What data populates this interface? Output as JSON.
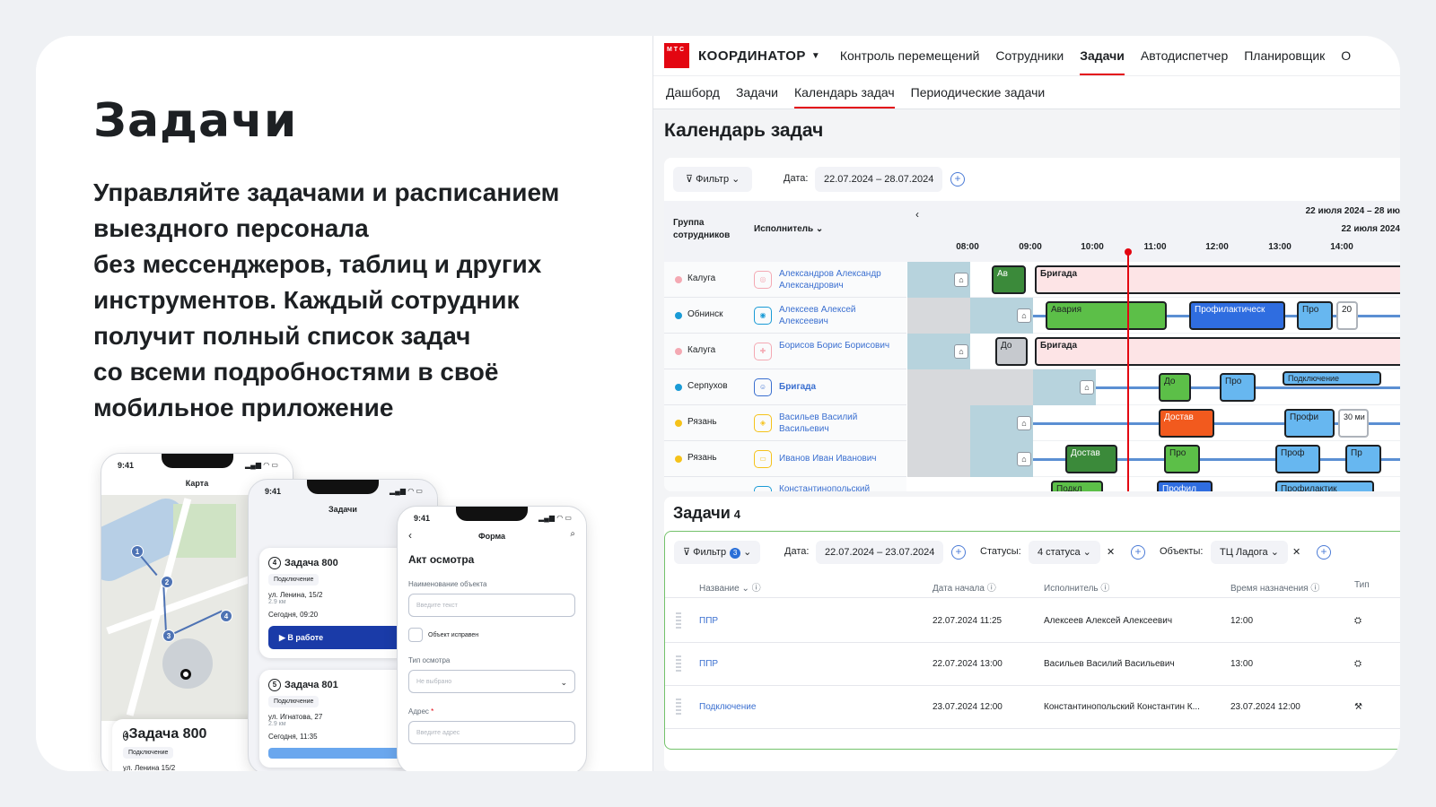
{
  "promo": {
    "title": "Задачи",
    "text": "Управляйте задачами и расписанием\nвыездного персонала\nбез мессенджеров, таблиц и других\nинструментов. Каждый сотрудник\nполучит полный список задач\nсо всеми подробностями в своё\nмобильное приложение"
  },
  "phones": {
    "map": {
      "time": "9:41",
      "title": "Карта",
      "task_title": "Задача 800",
      "task_num": "4",
      "chip": "Подключение",
      "address": "ул. Ленина 15/2",
      "pins": [
        "1",
        "2",
        "3",
        "4"
      ]
    },
    "list": {
      "time": "9:41",
      "title": "Задачи",
      "tasks": [
        {
          "num": "4",
          "title": "Задача 800",
          "chip": "Подключение",
          "address": "ул. Ленина, 15/2",
          "dist": "2.9 км",
          "when": "Сегодня, 09:20",
          "button": "▶ В работе"
        },
        {
          "num": "5",
          "title": "Задача 801",
          "chip": "Подключение",
          "address": "ул. Игнатова, 27",
          "dist": "2.9 км",
          "when": "Сегодня, 11:35"
        }
      ]
    },
    "form": {
      "time": "9:41",
      "title": "Форма",
      "heading": "Акт осмотра",
      "object_label": "Наименование объекта",
      "object_placeholder": "Введите текст",
      "checkbox": "Объект исправен",
      "type_label": "Тип осмотра",
      "type_placeholder": "Не выбрано",
      "address_label": "Адрес",
      "address_placeholder": "Введите адрес"
    }
  },
  "app": {
    "logo_text": "М Т С",
    "brand": "КООРДИНАТОР",
    "nav": [
      "Контроль перемещений",
      "Сотрудники",
      "Задачи",
      "Автодиспетчер",
      "Планировщик",
      "О"
    ],
    "nav_active": "Задачи",
    "subnav": [
      "Дашборд",
      "Задачи",
      "Календарь задач",
      "Периодические задачи"
    ],
    "subnav_active": "Календарь задач",
    "page_title": "Календарь задач",
    "calendar": {
      "filter_label": "Фильтр",
      "date_label": "Дата:",
      "date_range": "22.07.2024 – 28.07.2024",
      "col_group": "Группа сотрудников",
      "col_exec": "Исполнитель",
      "range_title": "22 июля 2024 – 28 июл",
      "day_title": "22 июля 2024",
      "hours": [
        "08:00",
        "09:00",
        "10:00",
        "11:00",
        "12:00",
        "13:00",
        "14:00"
      ],
      "rows": [
        {
          "city": "Калуга",
          "dot": "#f4a9b3",
          "name": "Александров Александр Александрович",
          "ava_color": "#f4a9b3"
        },
        {
          "city": "Обнинск",
          "dot": "#1a9bd6",
          "name": "Алексеев Алексей Алексеевич",
          "ava_color": "#1a9bd6"
        },
        {
          "city": "Калуга",
          "dot": "#f4a9b3",
          "name": "Борисов Борис Борисович",
          "ava_color": "#f4a9b3"
        },
        {
          "city": "Серпухов",
          "dot": "#1a9bd6",
          "name": "Бригада",
          "ava_color": "#3a6fd0"
        },
        {
          "city": "Рязань",
          "dot": "#f5c21a",
          "name": "Васильев Василий Васильевич",
          "ava_color": "#f5c21a"
        },
        {
          "city": "Рязань",
          "dot": "#f5c21a",
          "name": "Иванов Иван Иванович",
          "ava_color": "#f5c21a"
        },
        {
          "city": "",
          "dot": "#1a9bd6",
          "name": "Константинопольский",
          "ava_color": "#1a9bd6"
        }
      ],
      "blocks": {
        "r0": [
          "Ав",
          "Бригада"
        ],
        "r1": [
          "Авария",
          "Профилактическ",
          "Про",
          "20"
        ],
        "r2": [
          "До",
          "Бригада"
        ],
        "r3": [
          "До",
          "Про",
          "Подключение"
        ],
        "r4": [
          "Достав",
          "Профи",
          "30 ми"
        ],
        "r5": [
          "Достав",
          "Про",
          "Проф",
          "Пр"
        ],
        "r6": [
          "Подкл",
          "Профил",
          "Профилактик"
        ]
      }
    },
    "tasks": {
      "title": "Задачи",
      "count": "4",
      "filter_label": "Фильтр",
      "filter_count": "3",
      "date_label": "Дата:",
      "date_range": "22.07.2024 – 23.07.2024",
      "status_label": "Статусы:",
      "status_value": "4 статуса",
      "objects_label": "Объекты:",
      "objects_value": "ТЦ Ладога",
      "columns": [
        "Название",
        "Дата начала",
        "Исполнитель",
        "Время назначения",
        "Тип"
      ],
      "rows": [
        {
          "name": "ППР",
          "start": "22.07.2024 11:25",
          "exec": "Алексеев Алексей Алексеевич",
          "time": "12:00"
        },
        {
          "name": "ППР",
          "start": "22.07.2024 13:00",
          "exec": "Васильев Василий Васильевич",
          "time": "13:00"
        },
        {
          "name": "Подключение",
          "start": "23.07.2024 12:00",
          "exec": "Константинопольский Константин К...",
          "time": "23.07.2024 12:00"
        }
      ]
    }
  }
}
